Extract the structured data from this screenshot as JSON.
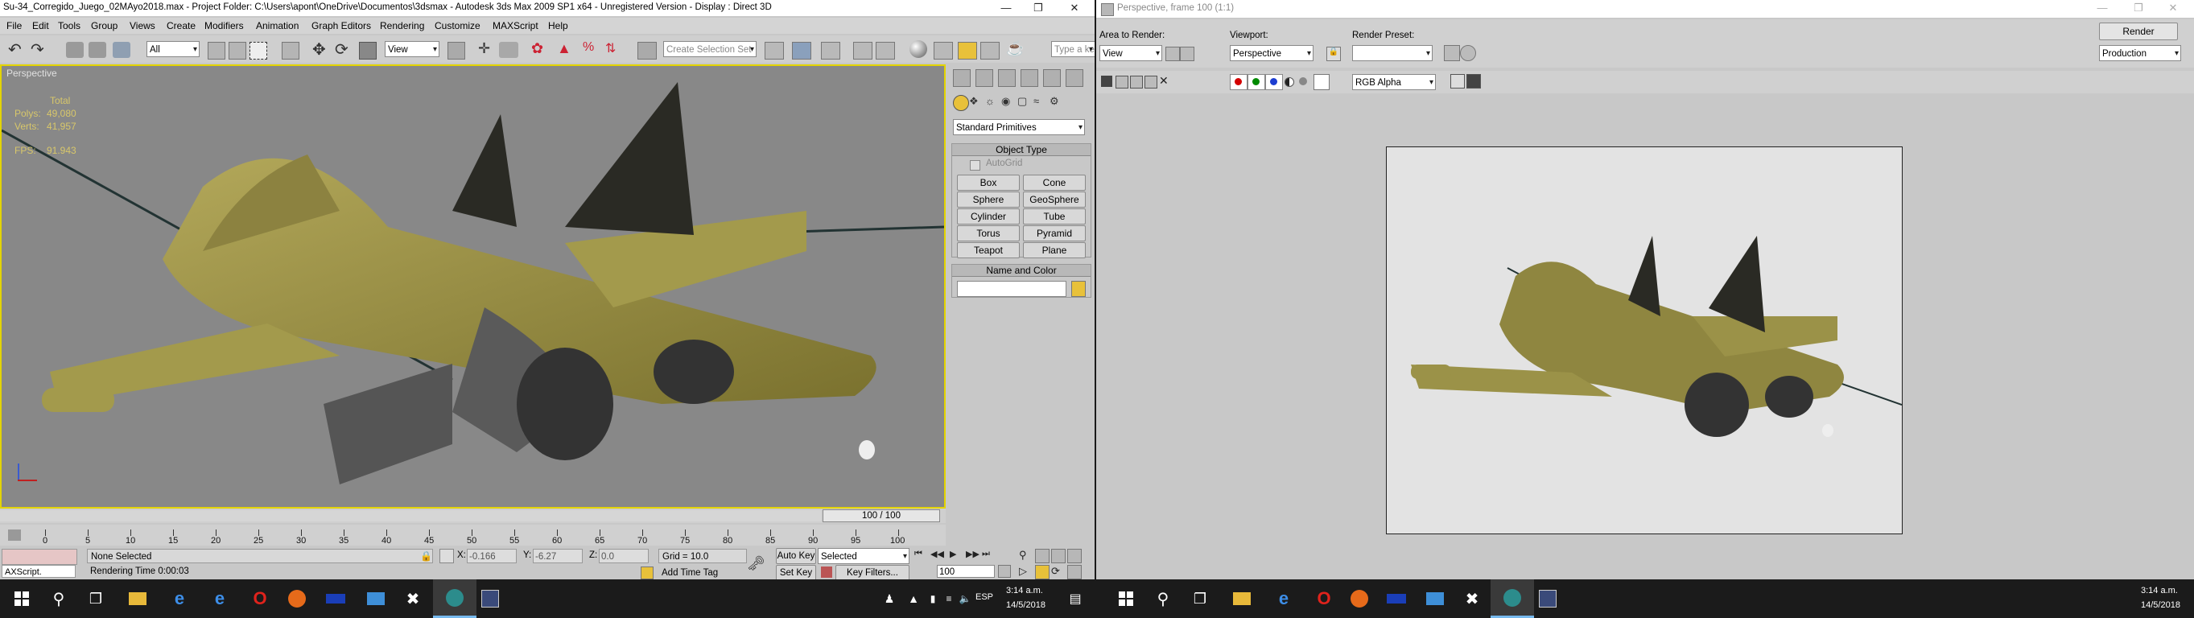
{
  "max_window": {
    "title": "Su-34_Corregido_Juego_02MAyo2018.max     - Project Folder: C:\\Users\\apont\\OneDrive\\Documentos\\3dsmax     - Autodesk 3ds Max  2009 SP1  x64     - Unregistered Version     - Display : Direct 3D",
    "menu": [
      "File",
      "Edit",
      "Tools",
      "Group",
      "Views",
      "Create",
      "Modifiers",
      "Animation",
      "Graph Editors",
      "Rendering",
      "Customize",
      "MAXScript",
      "Help"
    ],
    "toolbar": {
      "filter": "All",
      "ref_coord": "View",
      "selection_set": "Create Selection Set",
      "search_placeholder": "Type a ke"
    },
    "viewport": {
      "label": "Perspective",
      "stats": [
        {
          "label": "Total",
          "value": ""
        },
        {
          "label": "Polys:",
          "value": "49,080"
        },
        {
          "label": "Verts:",
          "value": "41,957"
        },
        {
          "label": "FPS:",
          "value": "91.943"
        }
      ]
    },
    "command_panel": {
      "category": "Standard Primitives",
      "object_type_title": "Object Type",
      "autogrid": "AutoGrid",
      "buttons": [
        "Box",
        "Cone",
        "Sphere",
        "GeoSphere",
        "Cylinder",
        "Tube",
        "Torus",
        "Pyramid",
        "Teapot",
        "Plane"
      ],
      "name_color_title": "Name and Color",
      "color": "#e8c13a"
    },
    "timeline": {
      "frame_display": "100 / 100",
      "ticks": [
        "0",
        "5",
        "10",
        "15",
        "20",
        "25",
        "30",
        "35",
        "40",
        "45",
        "50",
        "55",
        "60",
        "65",
        "70",
        "75",
        "80",
        "85",
        "90",
        "95",
        "100"
      ]
    },
    "status": {
      "maxscript": "AXScript.",
      "selection": "None Selected",
      "render_time": "Rendering Time  0:00:03",
      "x_label": "X:",
      "x": "-0.166",
      "y_label": "Y:",
      "y": "-6.27",
      "z_label": "Z:",
      "z": "0.0",
      "grid": "Grid = 10.0",
      "add_time_tag": "Add Time Tag",
      "auto_key": "Auto Key",
      "auto_key_mode": "Selected",
      "set_key": "Set Key",
      "key_filters": "Key Filters...",
      "frame": "100"
    }
  },
  "render_window": {
    "title": "Perspective, frame 100 (1:1)",
    "area_to_render_label": "Area to Render:",
    "area_to_render": "View",
    "viewport_label": "Viewport:",
    "viewport": "Perspective",
    "render_preset_label": "Render Preset:",
    "render_preset": "",
    "render_button": "Render",
    "mode": "Production",
    "channel": "RGB Alpha",
    "channel_colors": [
      "#d40000",
      "#008a00",
      "#1c3dd1"
    ]
  },
  "taskbar_left": {
    "lang": "ESP",
    "time": "3:14 a.m.",
    "date": "14/5/2018"
  },
  "taskbar_right": {
    "time": "3:14 a.m.",
    "date": "14/5/2018"
  }
}
